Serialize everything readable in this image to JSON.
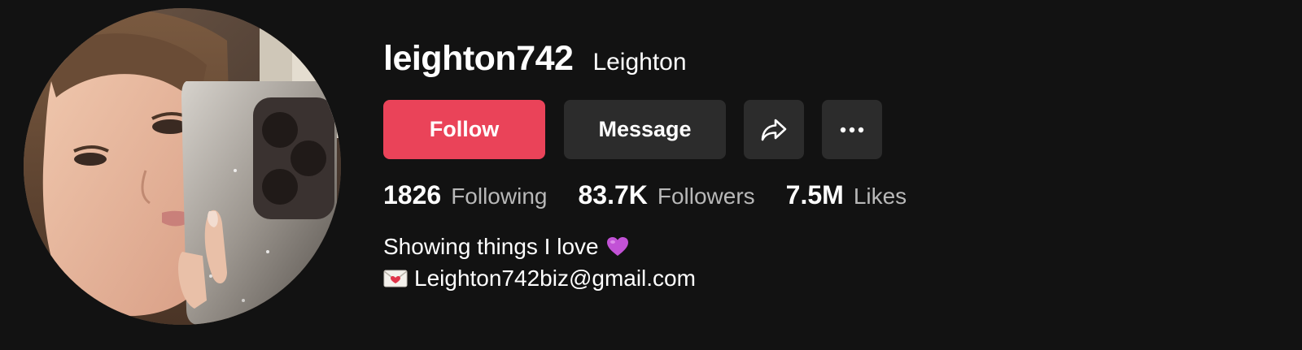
{
  "profile": {
    "username": "leighton742",
    "nickname": "Leighton",
    "avatar_icon": "profile-photo"
  },
  "actions": {
    "follow_label": "Follow",
    "message_label": "Message",
    "share_icon": "share-arrow-icon",
    "more_icon": "more-dots-icon",
    "follow_color": "#ea4359",
    "secondary_color": "#2c2c2c"
  },
  "stats": {
    "following": {
      "value": "1826",
      "label": "Following"
    },
    "followers": {
      "value": "83.7K",
      "label": "Followers"
    },
    "likes": {
      "value": "7.5M",
      "label": "Likes"
    }
  },
  "bio": {
    "line1": "Showing things I love",
    "line1_emoji": "purple-heart-icon",
    "line2_emoji": "love-letter-icon",
    "line2": "Leighton742biz@gmail.com"
  }
}
